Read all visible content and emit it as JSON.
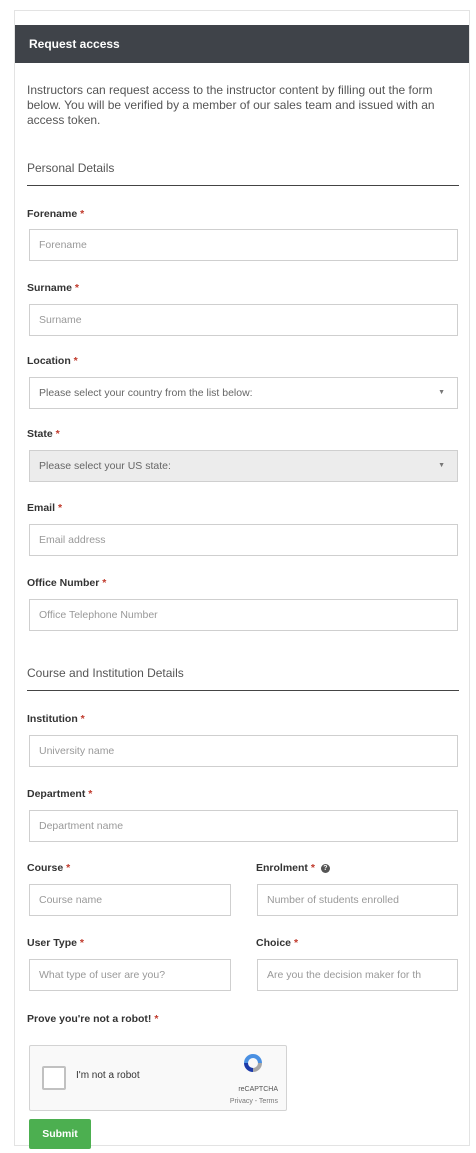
{
  "header": {
    "title": "Request access"
  },
  "intro": "Instructors can request access to the instructor content by filling out the form below. You will be verified by a member of our sales team and issued with an access token.",
  "sections": {
    "personal": "Personal Details",
    "course": "Course and Institution Details"
  },
  "required_marker": "*",
  "fields": {
    "forename": {
      "label": "Forename",
      "placeholder": "Forename"
    },
    "surname": {
      "label": "Surname",
      "placeholder": "Surname"
    },
    "location": {
      "label": "Location",
      "value": "Please select your country from the list below:"
    },
    "state": {
      "label": "State",
      "value": "Please select your US state:"
    },
    "email": {
      "label": "Email",
      "placeholder": "Email address"
    },
    "office": {
      "label": "Office Number",
      "placeholder": "Office Telephone Number"
    },
    "institution": {
      "label": "Institution",
      "placeholder": "University name"
    },
    "department": {
      "label": "Department",
      "placeholder": "Department name"
    },
    "course": {
      "label": "Course",
      "placeholder": "Course name"
    },
    "enrolment": {
      "label": "Enrolment",
      "placeholder": "Number of students enrolled"
    },
    "user_type": {
      "label": "User Type",
      "placeholder": "What type of user are you?"
    },
    "choice": {
      "label": "Choice",
      "placeholder": "Are you the decision maker for th"
    }
  },
  "captcha": {
    "label": "Prove you're not a robot!",
    "checkbox_text": "I'm not a robot",
    "brand": "reCAPTCHA",
    "links": "Privacy - Terms"
  },
  "submit_label": "Submit",
  "colors": {
    "header_bg": "#3f4349",
    "required": "#c0392b",
    "submit_bg": "#4caf50"
  }
}
